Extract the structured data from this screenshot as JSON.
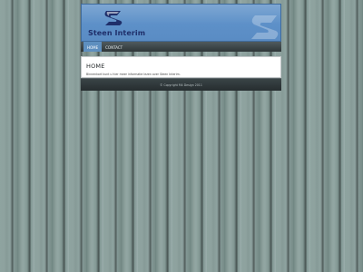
{
  "header": {
    "brand_name": "Steen Interim"
  },
  "nav": {
    "items": [
      {
        "label": "HOME",
        "active": true
      },
      {
        "label": "CONTACT",
        "active": false
      }
    ]
  },
  "main": {
    "title": "HOME",
    "text": "Binnenkort kunt u hier meer informatie lezen over Steen Interim."
  },
  "footer": {
    "copyright": "© Copyright M4 Design 2011"
  },
  "colors": {
    "banner": "#5d90c8",
    "brand_text": "#1f2f6a",
    "nav_active": "#5e8fbf",
    "nav_bar": "#3a4447"
  }
}
